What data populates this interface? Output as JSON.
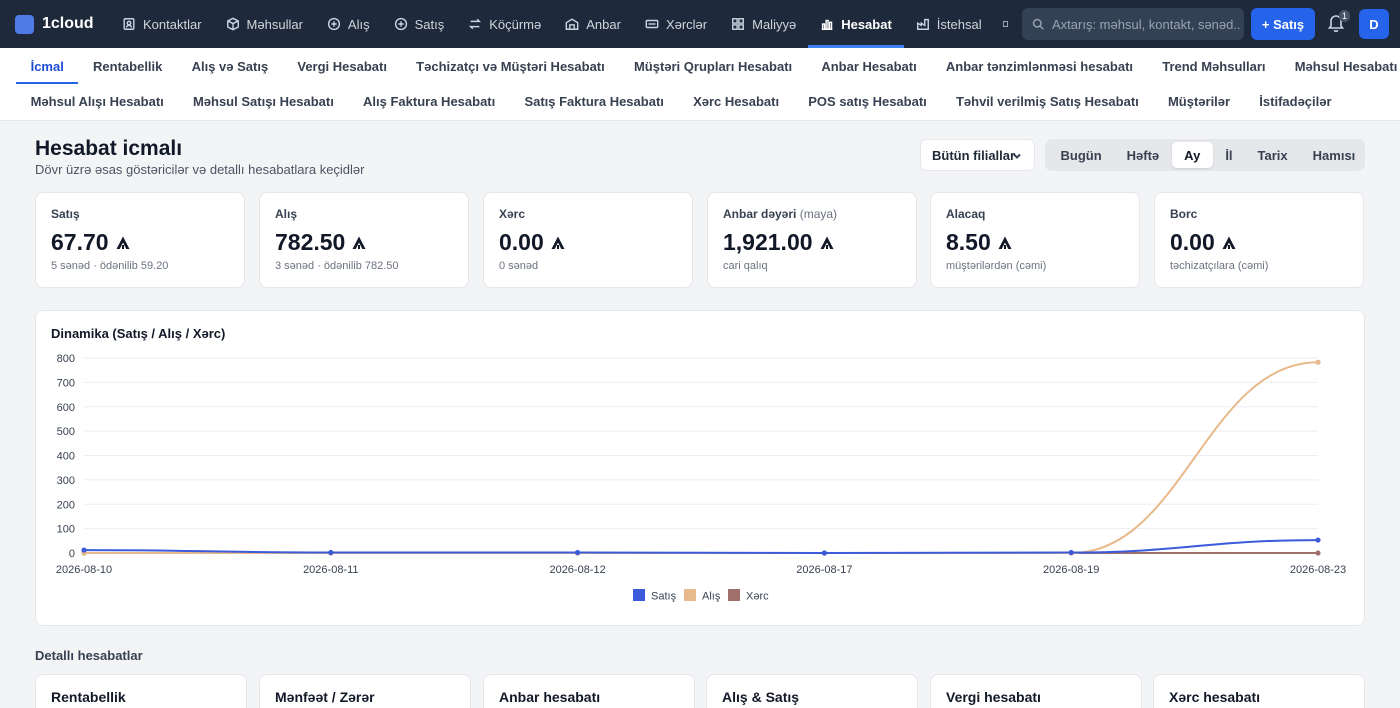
{
  "app": {
    "name": "1cloud"
  },
  "topnav": {
    "items": [
      {
        "label": "Kontaktlar",
        "icon": "contacts-icon"
      },
      {
        "label": "Məhsullar",
        "icon": "box-icon"
      },
      {
        "label": "Alış",
        "icon": "plus-circle-icon"
      },
      {
        "label": "Satış",
        "icon": "plus-circle-icon"
      },
      {
        "label": "Köçürmə",
        "icon": "transfer-icon"
      },
      {
        "label": "Anbar",
        "icon": "warehouse-icon"
      },
      {
        "label": "Xərclər",
        "icon": "money-icon"
      },
      {
        "label": "Maliyyə",
        "icon": "grid-icon"
      },
      {
        "label": "Hesabat",
        "icon": "bar-chart-icon",
        "active": true
      },
      {
        "label": "İstehsal",
        "icon": "production-icon"
      }
    ],
    "search_placeholder": "Axtarış: məhsul, kontakt, sənəd...",
    "new_sale_label": "+ Satış",
    "notification_count": "1",
    "avatar_initial": "D"
  },
  "subnav": {
    "row1": [
      "İcmal",
      "Rentabellik",
      "Alış və Satış",
      "Vergi Hesabatı",
      "Təchizatçı və Müştəri Hesabatı",
      "Müştəri Qrupları Hesabatı",
      "Anbar Hesabatı",
      "Anbar tənzimlənməsi hesabatı",
      "Trend Məhsulları",
      "Məhsul Hesabatı"
    ],
    "row2": [
      "Məhsul Alışı Hesabatı",
      "Məhsul Satışı Hesabatı",
      "Alış Faktura Hesabatı",
      "Satış Faktura Hesabatı",
      "Xərc Hesabatı",
      "POS satış Hesabatı",
      "Təhvil verilmiş Satış Hesabatı",
      "Müştərilər",
      "İstifadəçilər"
    ],
    "active": "İcmal"
  },
  "header": {
    "title": "Hesabat icmalı",
    "subtitle": "Dövr üzrə əsas göstəricilər və detallı hesabatlara keçidlər",
    "branch_select": "Bütün filiallar",
    "periods": [
      "Bugün",
      "Həftə",
      "Ay",
      "İl",
      "Tarix",
      "Hamısı"
    ],
    "active_period": "Ay"
  },
  "kpis": [
    {
      "label": "Satış",
      "label_note": "",
      "value": "67.70",
      "sub": "5 sənəd · ödənilib 59.20"
    },
    {
      "label": "Alış",
      "label_note": "",
      "value": "782.50",
      "sub": "3 sənəd · ödənilib 782.50"
    },
    {
      "label": "Xərc",
      "label_note": "",
      "value": "0.00",
      "sub": "0 sənəd"
    },
    {
      "label": "Anbar dəyəri",
      "label_note": "(maya)",
      "value": "1,921.00",
      "sub": "cari qalıq"
    },
    {
      "label": "Alacaq",
      "label_note": "",
      "value": "8.50",
      "sub": "müştərilərdən (cəmi)"
    },
    {
      "label": "Borc",
      "label_note": "",
      "value": "0.00",
      "sub": "təchizatçılara (cəmi)"
    }
  ],
  "chart_data": {
    "type": "line",
    "title": "Dinamika (Satış / Alış / Xərc)",
    "x": [
      "2026-08-10",
      "2026-08-11",
      "2026-08-12",
      "2026-08-17",
      "2026-08-19",
      "2026-08-23"
    ],
    "ylim": [
      0,
      800
    ],
    "yticks": [
      0,
      100,
      200,
      300,
      400,
      500,
      600,
      700,
      800
    ],
    "grid": true,
    "legend_position": "bottom",
    "series": [
      {
        "name": "Satış",
        "color": "#3b5bdb",
        "values": [
          12,
          2,
          2,
          0,
          2,
          53
        ]
      },
      {
        "name": "Alış",
        "color": "#e8b98a",
        "values": [
          0,
          0,
          0,
          0,
          0,
          782.5
        ]
      },
      {
        "name": "Xərc",
        "color": "#a0706a",
        "values": [
          0,
          0,
          0,
          0,
          0,
          0
        ]
      }
    ]
  },
  "details": {
    "heading": "Detallı hesabatlar",
    "cards": [
      "Rentabellik",
      "Mənfəət / Zərər",
      "Anbar hesabatı",
      "Alış & Satış",
      "Vergi hesabatı",
      "Xərc hesabatı"
    ]
  }
}
